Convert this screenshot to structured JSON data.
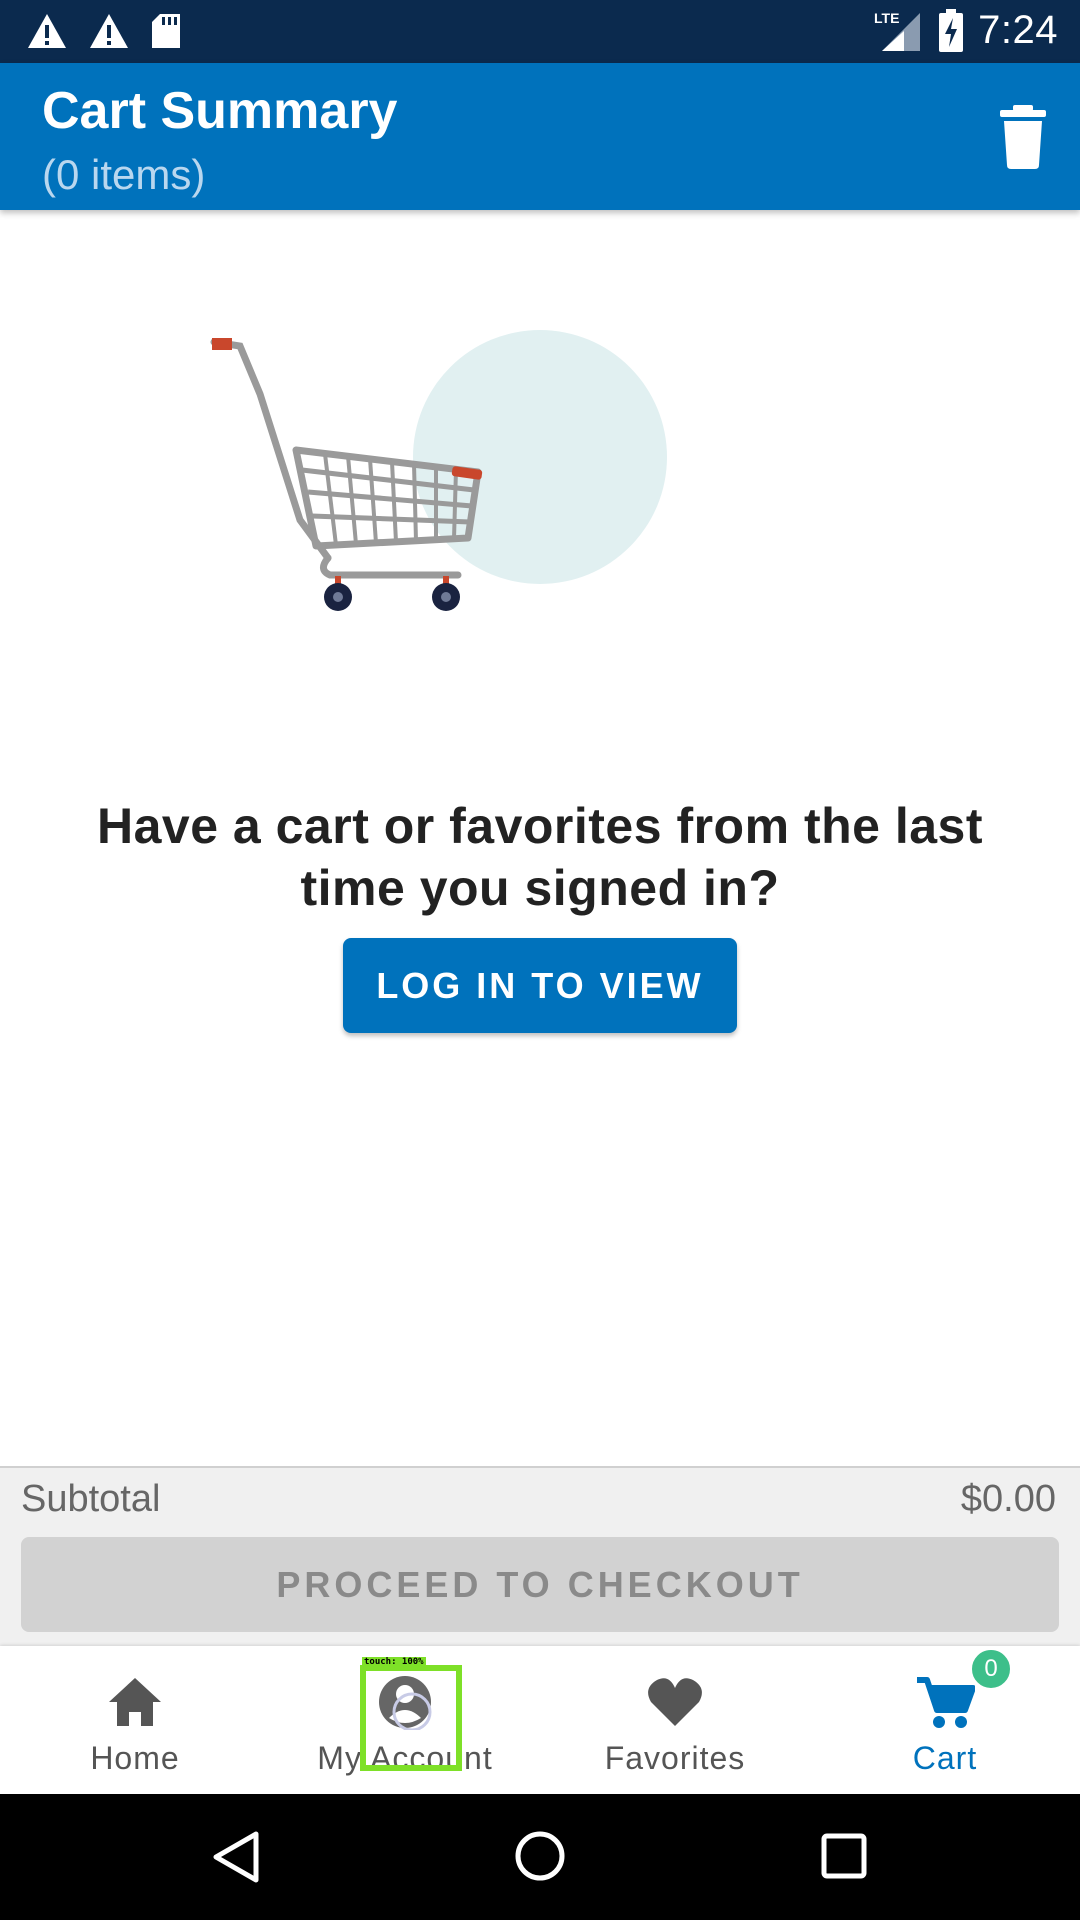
{
  "status_bar": {
    "time": "7:24",
    "left_icons": [
      "warning-icon",
      "warning-icon",
      "sd-card-icon"
    ],
    "right_icons": [
      "lte-signal-icon",
      "battery-charging-icon"
    ],
    "network": "LTE"
  },
  "app_bar": {
    "title": "Cart Summary",
    "subtitle": "(0 items)",
    "action_icon": "trash-icon"
  },
  "empty_state": {
    "message": "Have a cart or favorites from the last time you signed in?",
    "login_button": "LOG IN TO VIEW"
  },
  "summary": {
    "subtotal_label": "Subtotal",
    "subtotal_value": "$0.00",
    "checkout_button": "PROCEED TO CHECKOUT"
  },
  "bottom_nav": {
    "items": [
      {
        "label": "Home",
        "icon": "home-icon"
      },
      {
        "label": "My Account",
        "icon": "account-icon"
      },
      {
        "label": "Favorites",
        "icon": "heart-icon"
      },
      {
        "label": "Cart",
        "icon": "cart-icon",
        "active": true
      }
    ],
    "cart_badge": "0"
  },
  "touch_overlay": {
    "label": "touch: 100%"
  },
  "colors": {
    "primary": "#0072bc",
    "status_bar": "#0b2a4e",
    "badge": "#3dbf8a",
    "touch_highlight": "#7ee028"
  }
}
